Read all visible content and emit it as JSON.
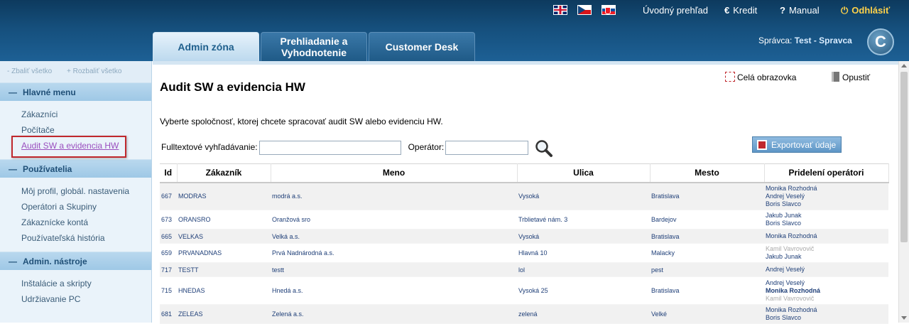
{
  "header": {
    "top_links": {
      "overview": "Úvodný prehľad",
      "credit": "Kredit",
      "manual": "Manual",
      "logout": "Odhlásiť"
    },
    "tabs": [
      {
        "label": "Admin zóna"
      },
      {
        "label": "Prehliadanie a Vyhodnotenie"
      },
      {
        "label": "Customer Desk"
      }
    ],
    "admin_prefix": "Správca:",
    "admin_name": "Test - Spravca",
    "logo_letter": "C"
  },
  "sidebar": {
    "collapse_all": "- Zbaliť všetko",
    "expand_all": "+ Rozbaliť všetko",
    "sections": [
      {
        "title": "Hlavné menu",
        "items": [
          "Zákazníci",
          "Počítače",
          "Audit SW a evidencia HW"
        ]
      },
      {
        "title": "Používatelia",
        "items": [
          "Môj profil, globál. nastavenia",
          "Operátori a Skupiny",
          "Zákaznícke kontá",
          "Používateľská história"
        ]
      },
      {
        "title": "Admin. nástroje",
        "items": [
          "Inštalácie a skripty",
          "Udržiavanie PC"
        ]
      }
    ]
  },
  "main": {
    "title": "Audit SW a evidencia HW",
    "fullscreen": "Celá obrazovka",
    "exit": "Opustiť",
    "intro": "Vyberte spoločnosť, ktorej chcete spracovať audit SW alebo evidenciu HW.",
    "search_label": "Fulltextové vyhľadávanie:",
    "operator_label": "Operátor:",
    "search_value": "",
    "operator_value": "",
    "export_label": "Exportovať údaje",
    "columns": [
      "Id",
      "Zákazník",
      "Meno",
      "Ulica",
      "Mesto",
      "Pridelení operátori"
    ],
    "rows": [
      {
        "id": "667",
        "customer": "MODRAS",
        "name": "modrá a.s.",
        "street": "Vysoká",
        "city": "Bratislava",
        "ops": [
          [
            "Monika Rozhodná",
            ""
          ],
          [
            "Andrej Veselý",
            ""
          ],
          [
            "Boris Slavco",
            ""
          ]
        ]
      },
      {
        "id": "673",
        "customer": "ORANSRO",
        "name": "Oranžová sro",
        "street": "Trblietavé nám. 3",
        "city": "Bardejov",
        "ops": [
          [
            "Jakub Junak",
            ""
          ],
          [
            "Boris Slavco",
            ""
          ]
        ]
      },
      {
        "id": "665",
        "customer": "VELKAS",
        "name": "Velká a.s.",
        "street": "Vysoká",
        "city": "Bratislava",
        "ops": [
          [
            "Monika Rozhodná",
            ""
          ]
        ]
      },
      {
        "id": "659",
        "customer": "PRVANADNAS",
        "name": "Prvá Nadnárodná a.s.",
        "street": "Hlavná 10",
        "city": "Malacky",
        "ops": [
          [
            "Kamil Vavrovovič",
            "dim"
          ],
          [
            "Jakub Junak",
            ""
          ]
        ]
      },
      {
        "id": "717",
        "customer": "TESTT",
        "name": "testt",
        "street": "lol",
        "city": "pest",
        "ops": [
          [
            "Andrej Veselý",
            ""
          ]
        ]
      },
      {
        "id": "715",
        "customer": "HNEDAS",
        "name": "Hnedá a.s.",
        "street": "Vysoká 25",
        "city": "Bratislava",
        "ops": [
          [
            "Andrej Veselý",
            ""
          ],
          [
            "Monika Rozhodná",
            "strong"
          ],
          [
            "Kamil Vavrovovič",
            "dim"
          ]
        ]
      },
      {
        "id": "681",
        "customer": "ZELEAS",
        "name": "Zelená a.s.",
        "street": "zelená",
        "city": "Velké",
        "ops": [
          [
            "Monika Rozhodná",
            ""
          ],
          [
            "Boris Slavco",
            ""
          ]
        ]
      }
    ]
  }
}
